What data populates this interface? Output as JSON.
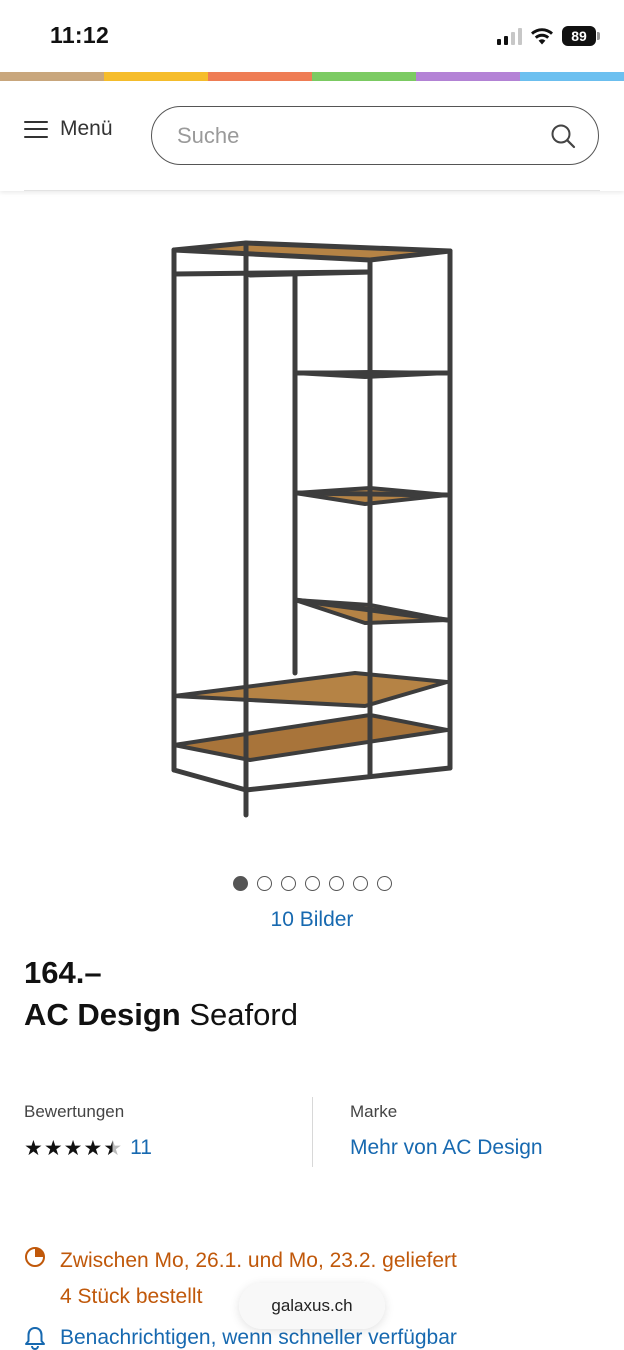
{
  "status_bar": {
    "time": "11:12",
    "battery": "89"
  },
  "rainbow_colors": [
    "#c9a77d",
    "#f6bd2c",
    "#ef7d55",
    "#7ccb63",
    "#b483d6",
    "#6cc0f0"
  ],
  "header": {
    "menu_label": "Menü",
    "search_placeholder": "Suche"
  },
  "gallery": {
    "dot_count": 7,
    "active_index": 0,
    "images_link": "10 Bilder"
  },
  "product": {
    "price": "164.–",
    "brand": "AC Design",
    "name": "Seaford"
  },
  "reviews": {
    "label": "Bewertungen",
    "rating": 4.5,
    "count": "11"
  },
  "brand_info": {
    "label": "Marke",
    "link": "Mehr von AC Design"
  },
  "delivery": {
    "line1": "Zwischen Mo, 26.1. und Mo, 23.2. geliefert",
    "line2": "4 Stück bestellt"
  },
  "notify": {
    "label": "Benachrichtigen, wenn schneller verfügbar"
  },
  "browser": {
    "domain": "galaxus.ch"
  },
  "colors": {
    "link": "#1769b0",
    "delivery": "#c0580a"
  }
}
